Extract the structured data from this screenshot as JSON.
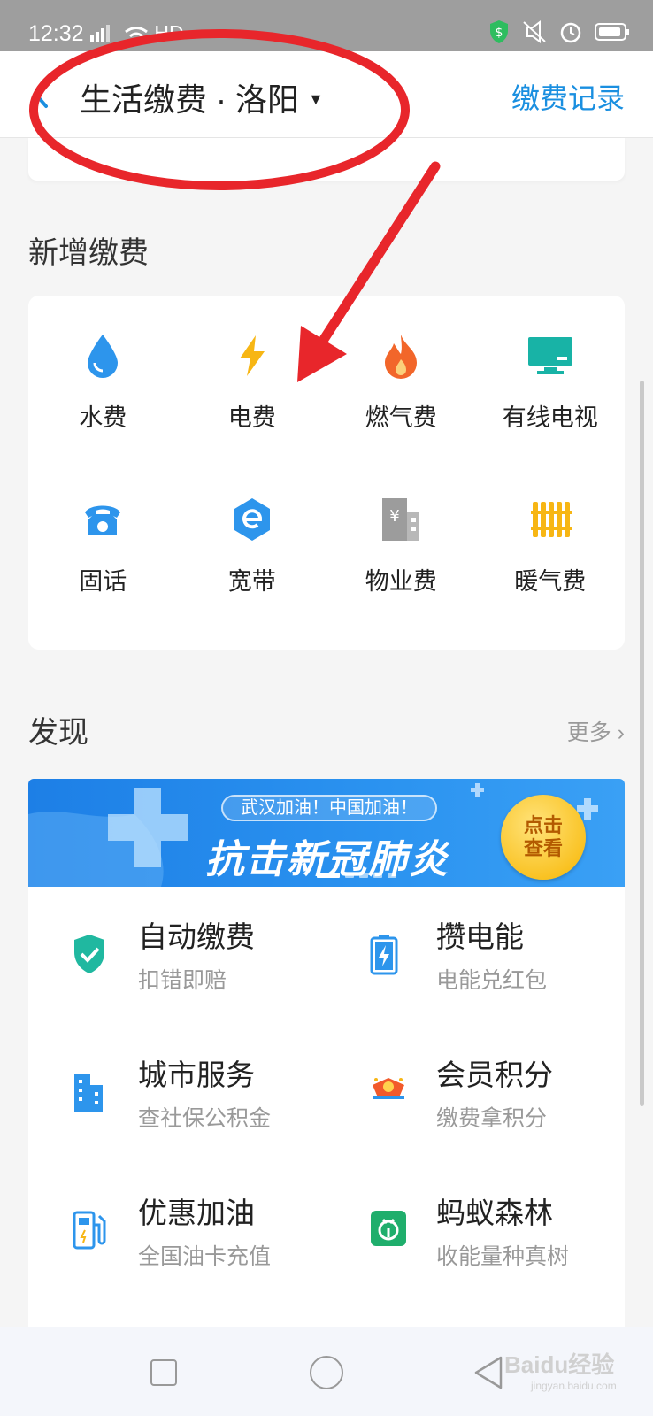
{
  "status_bar": {
    "time": "12:32",
    "network": "4G",
    "hd": "HD"
  },
  "header": {
    "title": "生活缴费 · 洛阳",
    "records_label": "缴费记录"
  },
  "new_payment": {
    "title": "新增缴费",
    "items": [
      {
        "label": "水费",
        "icon": "water-drop-icon"
      },
      {
        "label": "电费",
        "icon": "lightning-icon"
      },
      {
        "label": "燃气费",
        "icon": "flame-icon"
      },
      {
        "label": "有线电视",
        "icon": "tv-icon"
      },
      {
        "label": "固话",
        "icon": "telephone-icon"
      },
      {
        "label": "宽带",
        "icon": "broadband-icon"
      },
      {
        "label": "物业费",
        "icon": "property-building-icon"
      },
      {
        "label": "暖气费",
        "icon": "radiator-icon"
      }
    ]
  },
  "discover": {
    "title": "发现",
    "more_label": "更多",
    "banner": {
      "tag": "武汉加油！中国加油！",
      "headline": "抗击新冠肺炎",
      "badge_line1": "点击",
      "badge_line2": "查看"
    },
    "services": [
      {
        "title": "自动缴费",
        "subtitle": "扣错即赔",
        "icon": "shield-check-icon"
      },
      {
        "title": "攒电能",
        "subtitle": "电能兑红包",
        "icon": "battery-icon"
      },
      {
        "title": "城市服务",
        "subtitle": "查社保公积金",
        "icon": "city-buildings-icon"
      },
      {
        "title": "会员积分",
        "subtitle": "缴费拿积分",
        "icon": "member-points-icon"
      },
      {
        "title": "优惠加油",
        "subtitle": "全国油卡充值",
        "icon": "fuel-pump-icon"
      },
      {
        "title": "蚂蚁森林",
        "subtitle": "收能量种真树",
        "icon": "ant-forest-icon"
      }
    ]
  },
  "watermark": {
    "text": "Baidu经验",
    "url": "jingyan.baidu.com"
  },
  "colors": {
    "accent": "#1a8fe0",
    "annotation_red": "#e8262b"
  }
}
